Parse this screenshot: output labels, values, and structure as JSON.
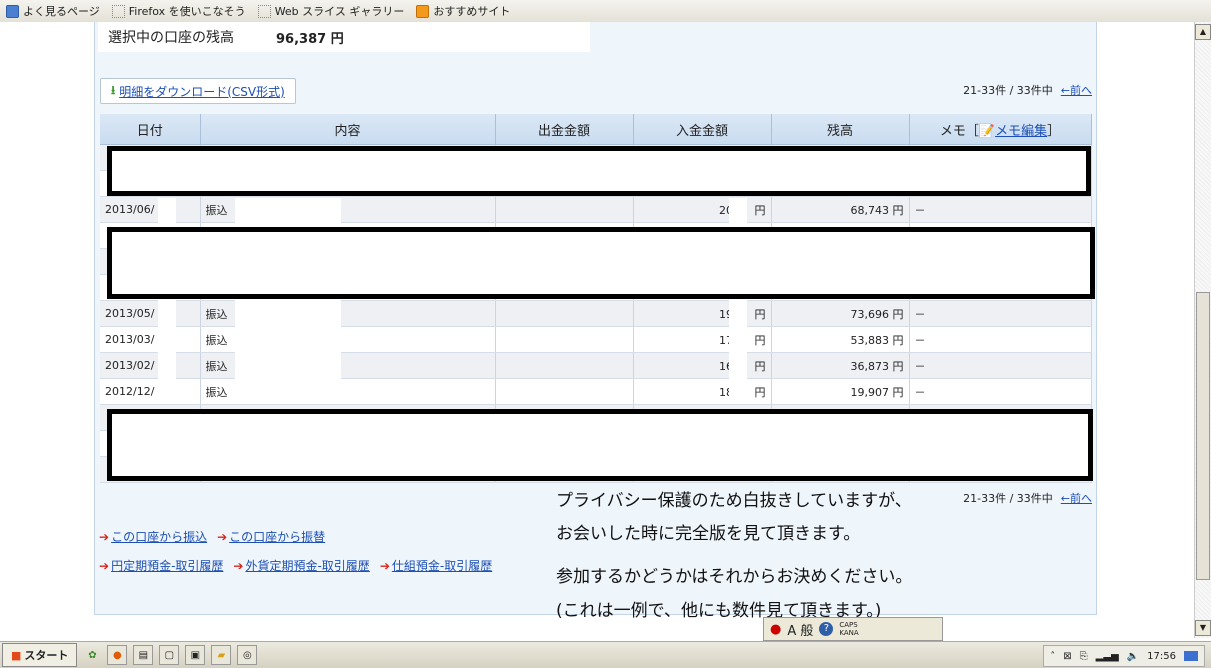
{
  "bookmarks": [
    "よく見るページ",
    "Firefox を使いこなそう",
    "Web スライス ギャラリー",
    "おすすめサイト"
  ],
  "balance": {
    "label": "選択中の口座の残高",
    "value": "96,387 円"
  },
  "download": {
    "label": "明細をダウンロード(CSV形式)"
  },
  "pager": {
    "range": "21-33件 / 33件中",
    "prev": "←前へ"
  },
  "table": {
    "headers": {
      "date": "日付",
      "desc": "内容",
      "out": "出金金額",
      "in": "入金金額",
      "bal": "残高",
      "memo": "メモ［",
      "memo_edit": "メモ編集",
      "memo_close": "］"
    },
    "rows": [
      {
        "date": "2013/06/",
        "desc": "振込",
        "out": "",
        "in": "20,",
        "yen": "円",
        "bal": "68,743 円",
        "memo": "－"
      },
      {
        "date": "2013/05/",
        "desc": "振込",
        "out": "",
        "in": "19,",
        "yen": "円",
        "bal": "73,696 円",
        "memo": "－"
      },
      {
        "date": "2013/03/",
        "desc": "振込",
        "out": "",
        "in": "17,",
        "yen": "円",
        "bal": "53,883 円",
        "memo": "－"
      },
      {
        "date": "2013/02/",
        "desc": "振込",
        "out": "",
        "in": "16,",
        "yen": "円",
        "bal": "36,873 円",
        "memo": "－"
      },
      {
        "date": "2012/12/",
        "desc": "振込",
        "out": "",
        "in": "18,",
        "yen": "円",
        "bal": "19,907 円",
        "memo": "－"
      }
    ]
  },
  "links": {
    "row1": [
      "この口座から振込",
      "この口座から振替"
    ],
    "row2": [
      "円定期預金-取引履歴",
      "外貨定期預金-取引履歴",
      "仕組預金-取引履歴"
    ]
  },
  "overlay": {
    "line1": "プライバシー保護のため白抜きしていますが、",
    "line2": "お会いした時に完全版を見て頂きます。",
    "line3": "参加するかどうかはそれからお決めください。",
    "line4": "(これは一例で、他にも数件見て頂きます。)"
  },
  "ime": {
    "mode": "A 般",
    "caps": "CAPS KANA"
  },
  "taskbar": {
    "start": "スタート",
    "clock": "17:56"
  }
}
